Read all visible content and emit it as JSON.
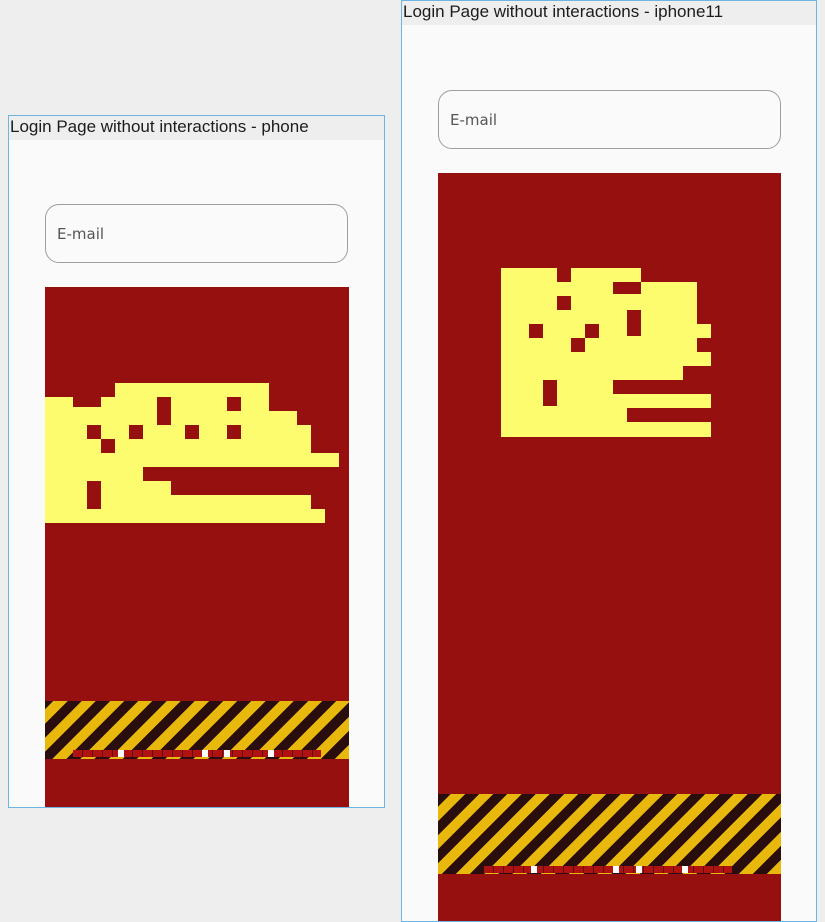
{
  "frames": [
    {
      "id": "phone",
      "title": "Login Page without interactions - phone",
      "email_placeholder": "E-mail"
    },
    {
      "id": "iphone11",
      "title": "Login Page without interactions - iphone11",
      "email_placeholder": "E-mail"
    }
  ],
  "colors": {
    "error_bg": "#961010",
    "glitch_fg": "#fcfc6e",
    "stripe_yellow": "#e8b80c",
    "stripe_dark": "#2a0d0d",
    "frame_border": "#6fb5e3"
  }
}
